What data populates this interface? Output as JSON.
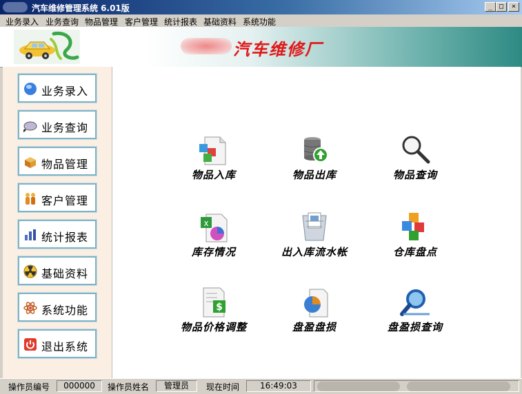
{
  "window": {
    "title": "汽车维修管理系统  6.01版",
    "minimize": "_",
    "maximize": "□",
    "close": "×"
  },
  "menu": [
    "业务录入",
    "业务查询",
    "物品管理",
    "客户管理",
    "统计报表",
    "基础资料",
    "系统功能"
  ],
  "banner": {
    "title": "汽车维修厂"
  },
  "sidebar": [
    {
      "label": "业务录入",
      "icon": "globe-icon"
    },
    {
      "label": "业务查询",
      "icon": "magnifier-icon"
    },
    {
      "label": "物品管理",
      "icon": "box-icon"
    },
    {
      "label": "客户管理",
      "icon": "customers-icon"
    },
    {
      "label": "统计报表",
      "icon": "chart-icon"
    },
    {
      "label": "基础资料",
      "icon": "radiation-icon"
    },
    {
      "label": "系统功能",
      "icon": "atom-icon"
    },
    {
      "label": "退出系统",
      "icon": "power-icon"
    }
  ],
  "functions": [
    {
      "label": "物品入库",
      "icon": "stock-in-icon"
    },
    {
      "label": "物品出库",
      "icon": "stock-out-icon"
    },
    {
      "label": "物品查询",
      "icon": "search-icon"
    },
    {
      "label": "库存情况",
      "icon": "inventory-report-icon"
    },
    {
      "label": "出入库流水帐",
      "icon": "ledger-icon"
    },
    {
      "label": "仓库盘点",
      "icon": "cubes-icon"
    },
    {
      "label": "物品价格调整",
      "icon": "price-adjust-icon"
    },
    {
      "label": "盘盈盘损",
      "icon": "pie-document-icon"
    },
    {
      "label": "盘盈损查询",
      "icon": "magnifier-blue-icon"
    }
  ],
  "status": {
    "op_id_label": "操作员编号",
    "op_id": "000000",
    "op_name_label": "操作员姓名",
    "op_name": "管理员",
    "time_label": "现在时间",
    "time": "16:49:03"
  }
}
